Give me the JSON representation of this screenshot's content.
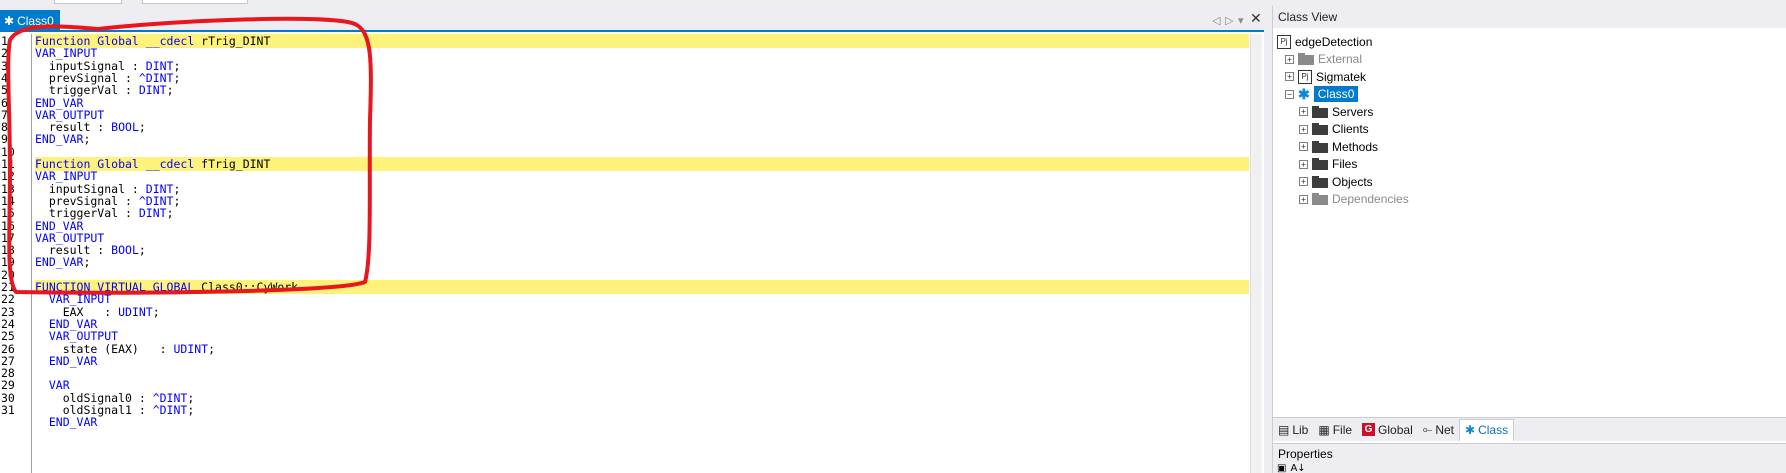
{
  "editor": {
    "tab_label": "Class0",
    "tab_icon": "class-icon",
    "lines": [
      {
        "num": "1",
        "hl": true,
        "tokens": [
          {
            "k": "Function Global __cdecl "
          },
          {
            "i": "rTrig_DINT"
          }
        ]
      },
      {
        "num": "2",
        "tokens": [
          {
            "k": "VAR_INPUT"
          }
        ]
      },
      {
        "num": "3",
        "tokens": [
          {
            "i": "  inputSignal : "
          },
          {
            "k": "DINT"
          },
          {
            "i": ";"
          }
        ]
      },
      {
        "num": "4",
        "tokens": [
          {
            "i": "  prevSignal : "
          },
          {
            "k": "^DINT"
          },
          {
            "i": ";"
          }
        ]
      },
      {
        "num": "5",
        "tokens": [
          {
            "i": "  triggerVal : "
          },
          {
            "k": "DINT"
          },
          {
            "i": ";"
          }
        ]
      },
      {
        "num": "6",
        "tokens": [
          {
            "k": "END_VAR"
          }
        ]
      },
      {
        "num": "7",
        "tokens": [
          {
            "k": "VAR_OUTPUT"
          }
        ]
      },
      {
        "num": "8",
        "tokens": [
          {
            "i": "  result : "
          },
          {
            "k": "BOOL"
          },
          {
            "i": ";"
          }
        ]
      },
      {
        "num": "9",
        "tokens": [
          {
            "k": "END_VAR"
          },
          {
            "i": ";"
          }
        ]
      },
      {
        "num": "10",
        "tokens": []
      },
      {
        "num": "11",
        "hl": true,
        "tokens": [
          {
            "k": "Function Global __cdecl "
          },
          {
            "i": "fTrig_DINT"
          }
        ]
      },
      {
        "num": "12",
        "tokens": [
          {
            "k": "VAR_INPUT"
          }
        ]
      },
      {
        "num": "13",
        "tokens": [
          {
            "i": "  inputSignal : "
          },
          {
            "k": "DINT"
          },
          {
            "i": ";"
          }
        ]
      },
      {
        "num": "14",
        "tokens": [
          {
            "i": "  prevSignal : "
          },
          {
            "k": "^DINT"
          },
          {
            "i": ";"
          }
        ]
      },
      {
        "num": "15",
        "tokens": [
          {
            "i": "  triggerVal : "
          },
          {
            "k": "DINT"
          },
          {
            "i": ";"
          }
        ]
      },
      {
        "num": "16",
        "tokens": [
          {
            "k": "END_VAR"
          }
        ]
      },
      {
        "num": "17",
        "tokens": [
          {
            "k": "VAR_OUTPUT"
          }
        ]
      },
      {
        "num": "18",
        "tokens": [
          {
            "i": "  result : "
          },
          {
            "k": "BOOL"
          },
          {
            "i": ";"
          }
        ]
      },
      {
        "num": "19",
        "tokens": [
          {
            "k": "END_VAR"
          },
          {
            "i": ";"
          }
        ]
      },
      {
        "num": "20",
        "tokens": []
      },
      {
        "num": "21",
        "hl": true,
        "tokens": [
          {
            "k": "FUNCTION VIRTUAL GLOBAL "
          },
          {
            "i": "Class0::CyWork"
          }
        ]
      },
      {
        "num": "22",
        "tokens": [
          {
            "k": "  VAR_INPUT"
          }
        ]
      },
      {
        "num": "23",
        "tokens": [
          {
            "i": "    EAX   : "
          },
          {
            "k": "UDINT"
          },
          {
            "i": ";"
          }
        ]
      },
      {
        "num": "24",
        "tokens": [
          {
            "k": "  END_VAR"
          }
        ]
      },
      {
        "num": "25",
        "tokens": [
          {
            "k": "  VAR_OUTPUT"
          }
        ]
      },
      {
        "num": "26",
        "tokens": [
          {
            "i": "    state (EAX)   : "
          },
          {
            "k": "UDINT"
          },
          {
            "i": ";"
          }
        ]
      },
      {
        "num": "27",
        "tokens": [
          {
            "k": "  END_VAR"
          }
        ]
      },
      {
        "num": "28",
        "tokens": []
      },
      {
        "num": "29",
        "tokens": [
          {
            "k": "  VAR"
          }
        ]
      },
      {
        "num": "30",
        "tokens": [
          {
            "i": "    oldSignal0 : "
          },
          {
            "k": "^DINT"
          },
          {
            "i": ";"
          }
        ]
      },
      {
        "num": "31",
        "tokens": [
          {
            "i": "    oldSignal1 : "
          },
          {
            "k": "^DINT"
          },
          {
            "i": ";"
          }
        ]
      },
      {
        "num": "",
        "tokens": [
          {
            "k": "  END_VAR"
          }
        ]
      }
    ]
  },
  "class_view": {
    "title": "Class View",
    "tree": [
      {
        "label": "edgeDetection",
        "icon": "project-icon",
        "expander": "",
        "indent": 0
      },
      {
        "label": "External",
        "icon": "folder-icon",
        "expander": "+",
        "indent": 1,
        "muted": true
      },
      {
        "label": "Sigmatek",
        "icon": "project-icon",
        "expander": "+",
        "indent": 1
      },
      {
        "label": "Class0",
        "icon": "class-icon",
        "expander": "−",
        "indent": 1,
        "selected": true
      },
      {
        "label": "Servers",
        "icon": "folder-icon",
        "expander": "+",
        "indent": 2
      },
      {
        "label": "Clients",
        "icon": "folder-icon",
        "expander": "+",
        "indent": 2
      },
      {
        "label": "Methods",
        "icon": "folder-icon",
        "expander": "+",
        "indent": 2
      },
      {
        "label": "Files",
        "icon": "folder-icon",
        "expander": "+",
        "indent": 2
      },
      {
        "label": "Objects",
        "icon": "folder-icon",
        "expander": "+",
        "indent": 2
      },
      {
        "label": "Dependencies",
        "icon": "folder-icon",
        "expander": "+",
        "indent": 2,
        "muted": true
      }
    ],
    "tabs": [
      {
        "label": "Lib",
        "icon": "library-icon"
      },
      {
        "label": "File",
        "icon": "file-icon"
      },
      {
        "label": "Global",
        "icon": "global-icon"
      },
      {
        "label": "Net",
        "icon": "network-icon"
      },
      {
        "label": "Class",
        "icon": "class-icon",
        "active": true
      }
    ]
  },
  "properties": {
    "title": "Properties",
    "sort_label": "A↓"
  },
  "colors": {
    "accent": "#007acc",
    "keyword": "#0000ff",
    "highlight": "#fff27a",
    "annotation": "#e8161e"
  }
}
